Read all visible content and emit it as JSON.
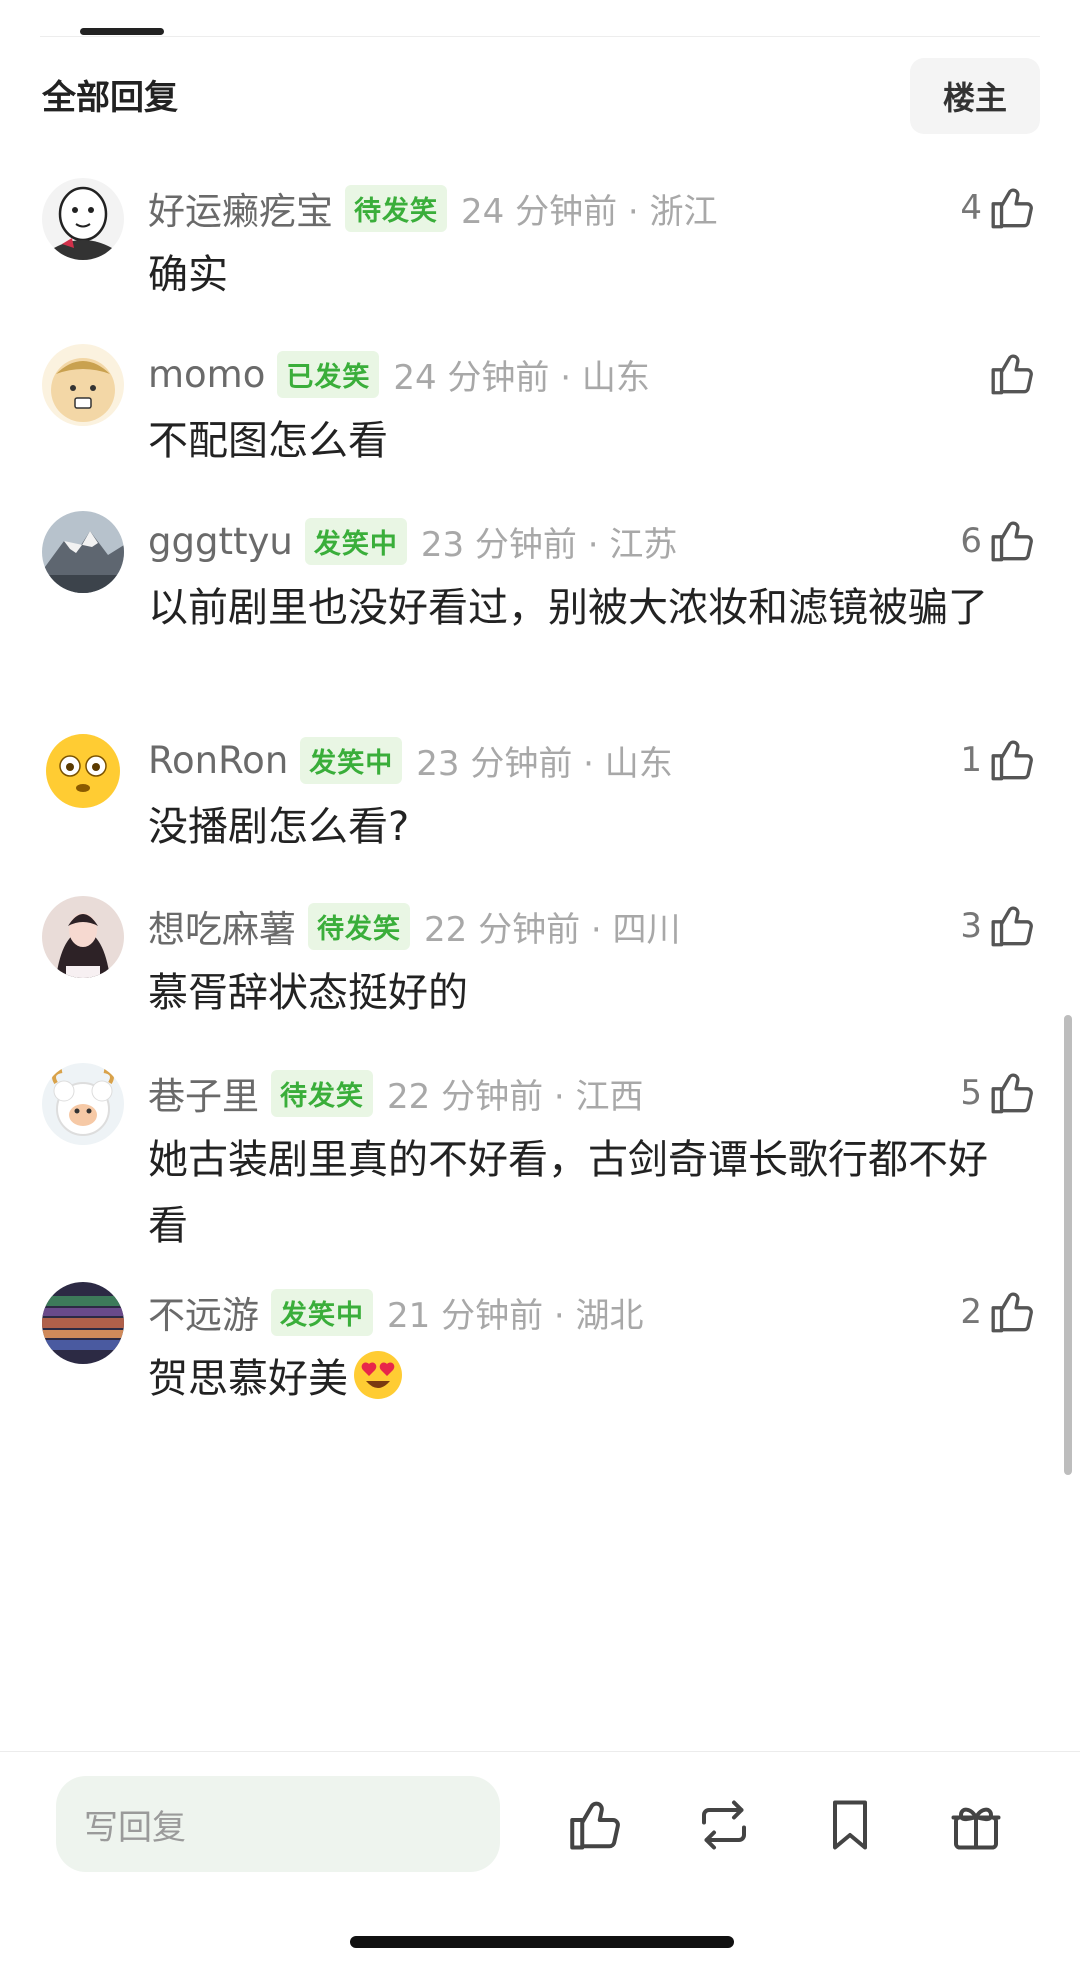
{
  "header": {
    "title": "全部回复",
    "filter_label": "楼主"
  },
  "comments": [
    {
      "username": "好运癞疙宝",
      "badge": "待发笑",
      "time": "24 分钟前 · 浙江",
      "text": "确实",
      "likes": "4"
    },
    {
      "username": "momo",
      "badge": "已发笑",
      "time": "24 分钟前 · 山东",
      "text": "不配图怎么看",
      "likes": ""
    },
    {
      "username": "gggttyu",
      "badge": "发笑中",
      "time": "23 分钟前 · 江苏",
      "text": "以前剧里也没好看过，别被大浓妆和滤镜被骗了",
      "likes": "6"
    },
    {
      "username": "RonRon",
      "badge": "发笑中",
      "time": "23 分钟前 · 山东",
      "text": "没播剧怎么看?",
      "likes": "1"
    },
    {
      "username": "想吃麻薯",
      "badge": "待发笑",
      "time": "22 分钟前 · 四川",
      "text": "慕胥辞状态挺好的",
      "likes": "3"
    },
    {
      "username": "巷子里",
      "badge": "待发笑",
      "time": "22 分钟前 · 江西",
      "text": "她古装剧里真的不好看，古剑奇谭长歌行都不好看",
      "likes": "5"
    },
    {
      "username": "不远游",
      "badge": "发笑中",
      "time": "21 分钟前 · 湖北",
      "text": "贺思慕好美",
      "likes": "2",
      "emoji": "heart-eyes-emoji"
    }
  ],
  "bottom_bar": {
    "reply_placeholder": "写回复",
    "actions": [
      "like-icon",
      "repost-icon",
      "bookmark-icon",
      "gift-icon"
    ]
  },
  "colors": {
    "badge_text": "#3aae3a",
    "badge_bg": "#e9f6e4",
    "meta_gray": "#a8a8a8"
  }
}
